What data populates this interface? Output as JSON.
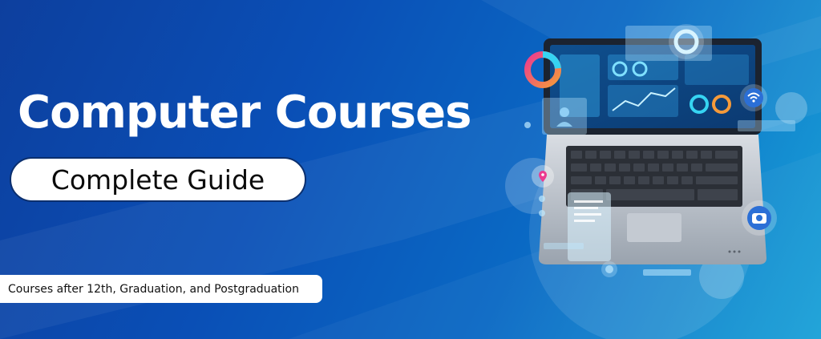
{
  "banner": {
    "headline": "Computer Courses",
    "subheadline": "Complete Guide",
    "tagline": "Courses after 12th, Graduation, and Postgraduation"
  },
  "illustration": {
    "subject": "laptop-icon",
    "floating_icons": [
      "wifi-icon",
      "camera-icon",
      "location-pin-icon",
      "donut-chart-icon",
      "user-icon"
    ]
  },
  "colors": {
    "background_dark": "#0d3f9e",
    "background_light": "#1aa2d8",
    "text_primary": "#ffffff",
    "pill_background": "#ffffff",
    "pill_border": "#0b2f6e",
    "accent_pink": "#ec3b8f",
    "accent_orange": "#f59a3a",
    "accent_cyan": "#36d4f2"
  }
}
